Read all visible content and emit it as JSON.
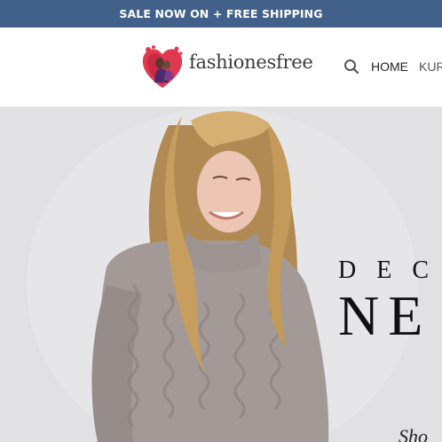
{
  "announcement": {
    "text": "SALE NOW ON + FREE SHIPPING"
  },
  "header": {
    "logo_text": "fashionesfree",
    "search_icon": "search-icon",
    "nav": [
      {
        "label": "HOME"
      },
      {
        "label": "KUR"
      }
    ]
  },
  "hero": {
    "line1": "DEC",
    "line2": "NE",
    "cta": "Sho"
  },
  "colors": {
    "announcement_bg": "#42618a",
    "logo_heart": "#e0384e",
    "hero_bg": "#e1e1e3"
  }
}
